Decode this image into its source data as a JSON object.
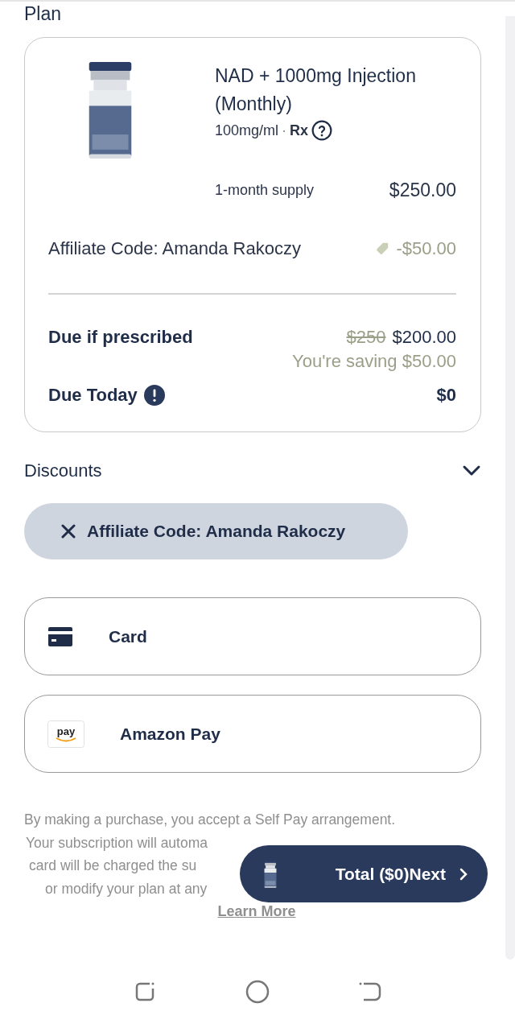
{
  "section_title": "Plan",
  "product": {
    "name": "NAD + 1000mg Injection (Monthly)",
    "concentration": "100mg/ml",
    "separator": "·",
    "rx": "Rx",
    "supply": "1-month supply",
    "price": "$250.00"
  },
  "discount_line": {
    "label": "Affiliate Code: Amanda Rakoczy",
    "amount": "-$50.00"
  },
  "due_if_prescribed": {
    "label": "Due if prescribed",
    "original": "$250",
    "price": "$200.00",
    "saving": "You're saving $50.00"
  },
  "due_today": {
    "label": "Due Today",
    "amount": "$0"
  },
  "discounts": {
    "title": "Discounts"
  },
  "applied_codes": [
    {
      "label": "Affiliate Code: Amanda Rakoczy"
    }
  ],
  "payment_methods": [
    {
      "kind": "card",
      "label": "Card"
    },
    {
      "kind": "amazon",
      "label": "Amazon Pay",
      "logo_text": "pay"
    }
  ],
  "disclaimer_lines": [
    "By making a purchase, you accept a Self Pay arrangement.",
    "Your subscription will automa",
    "card will be charged the su",
    "or modify your plan at any"
  ],
  "learn_more": "Learn More",
  "checkout_button": {
    "label": "Total ($0)Next"
  }
}
